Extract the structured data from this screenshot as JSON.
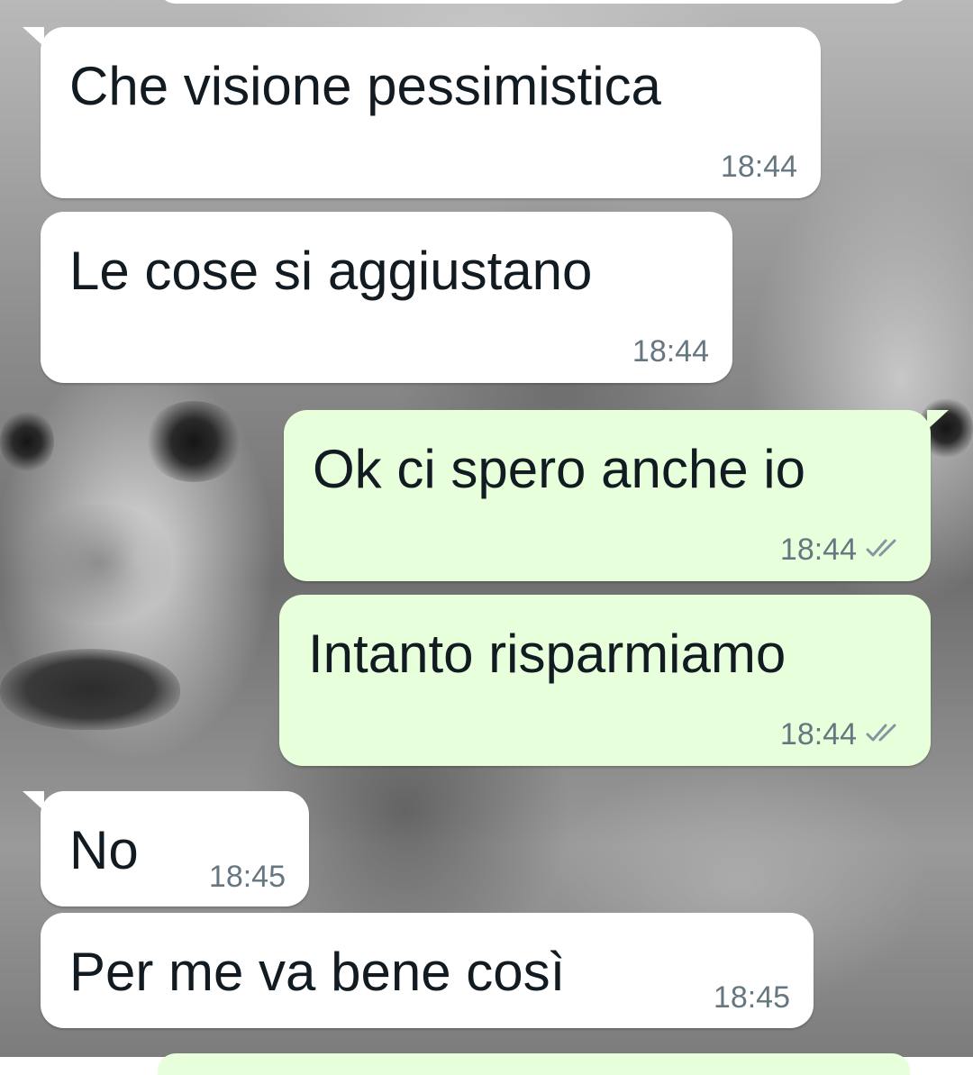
{
  "colors": {
    "incoming_bubble": "#ffffff",
    "outgoing_bubble": "#e7ffdb",
    "text": "#111b21",
    "timestamp": "#667781",
    "read_ticks": "#8696a0"
  },
  "messages": [
    {
      "direction": "incoming",
      "text": "Che visione pessimistica",
      "time": "18:44"
    },
    {
      "direction": "incoming",
      "text": "Le cose si aggiustano",
      "time": "18:44"
    },
    {
      "direction": "outgoing",
      "text": "Ok ci spero anche io",
      "time": "18:44",
      "status_icon": "double-check-icon"
    },
    {
      "direction": "outgoing",
      "text": "Intanto risparmiamo",
      "time": "18:44",
      "status_icon": "double-check-icon"
    },
    {
      "direction": "incoming",
      "text": "No",
      "time": "18:45"
    },
    {
      "direction": "incoming",
      "text": "Per me va bene così",
      "time": "18:45"
    }
  ]
}
